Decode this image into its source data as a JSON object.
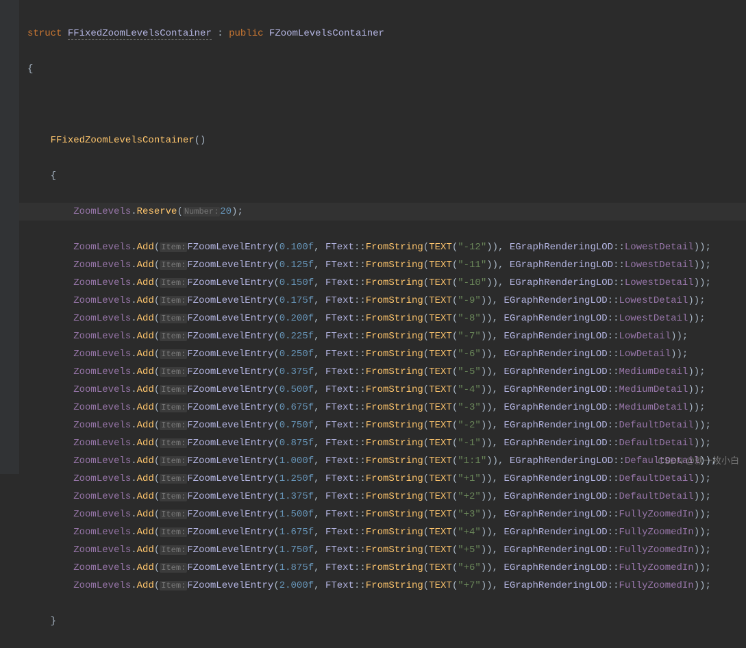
{
  "decl": {
    "struct_kw": "struct",
    "name": "FFixedZoomLevelsContainer",
    "sep": " : ",
    "public_kw": "public",
    "base": "FZoomLevelsContainer"
  },
  "ctor_name": "FFixedZoomLevelsContainer",
  "hints": {
    "number": "Number:",
    "item": "Item:"
  },
  "field": "ZoomLevels",
  "reserve_fn": "Reserve",
  "reserve_val": "20",
  "add_fn": "Add",
  "entry_type": "FZoomLevelEntry",
  "ftext": "FText",
  "fromstring": "FromString",
  "text_macro": "TEXT",
  "enum": "EGraphRenderingLOD",
  "rows": [
    {
      "f": "0.100f",
      "txt": "\"-12\"",
      "lod": "LowestDetail"
    },
    {
      "f": "0.125f",
      "txt": "\"-11\"",
      "lod": "LowestDetail"
    },
    {
      "f": "0.150f",
      "txt": "\"-10\"",
      "lod": "LowestDetail"
    },
    {
      "f": "0.175f",
      "txt": "\"-9\"",
      "lod": "LowestDetail"
    },
    {
      "f": "0.200f",
      "txt": "\"-8\"",
      "lod": "LowestDetail"
    },
    {
      "f": "0.225f",
      "txt": "\"-7\"",
      "lod": "LowDetail"
    },
    {
      "f": "0.250f",
      "txt": "\"-6\"",
      "lod": "LowDetail"
    },
    {
      "f": "0.375f",
      "txt": "\"-5\"",
      "lod": "MediumDetail"
    },
    {
      "f": "0.500f",
      "txt": "\"-4\"",
      "lod": "MediumDetail"
    },
    {
      "f": "0.675f",
      "txt": "\"-3\"",
      "lod": "MediumDetail"
    },
    {
      "f": "0.750f",
      "txt": "\"-2\"",
      "lod": "DefaultDetail"
    },
    {
      "f": "0.875f",
      "txt": "\"-1\"",
      "lod": "DefaultDetail"
    },
    {
      "f": "1.000f",
      "txt": "\"1:1\"",
      "lod": "DefaultDetail"
    },
    {
      "f": "1.250f",
      "txt": "\"+1\"",
      "lod": "DefaultDetail"
    },
    {
      "f": "1.375f",
      "txt": "\"+2\"",
      "lod": "DefaultDetail"
    },
    {
      "f": "1.500f",
      "txt": "\"+3\"",
      "lod": "FullyZoomedIn"
    },
    {
      "f": "1.675f",
      "txt": "\"+4\"",
      "lod": "FullyZoomedIn"
    },
    {
      "f": "1.750f",
      "txt": "\"+5\"",
      "lod": "FullyZoomedIn"
    },
    {
      "f": "1.875f",
      "txt": "\"+6\"",
      "lod": "FullyZoomedIn"
    },
    {
      "f": "2.000f",
      "txt": "\"+7\"",
      "lod": "FullyZoomedIn"
    }
  ],
  "watermark": "CSDN @就一枚小白"
}
